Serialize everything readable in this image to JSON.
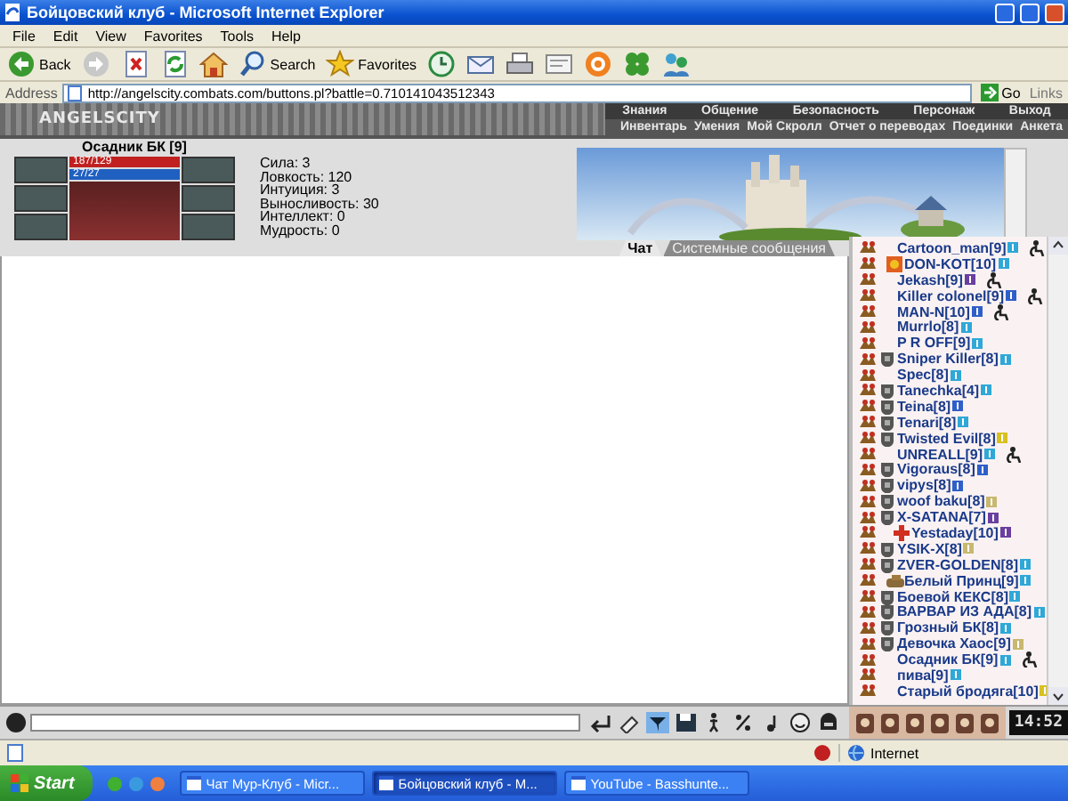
{
  "window": {
    "title": "Бойцовский клуб - Microsoft Internet Explorer"
  },
  "menu": [
    "File",
    "Edit",
    "View",
    "Favorites",
    "Tools",
    "Help"
  ],
  "toolbar": [
    {
      "kind": "back",
      "label": "Back"
    },
    {
      "kind": "forward"
    },
    {
      "kind": "stop"
    },
    {
      "kind": "refresh"
    },
    {
      "kind": "home"
    },
    {
      "kind": "search",
      "label": "Search"
    },
    {
      "kind": "favorites",
      "label": "Favorites"
    },
    {
      "kind": "history"
    },
    {
      "kind": "mail"
    },
    {
      "kind": "print"
    },
    {
      "kind": "edit"
    },
    {
      "kind": "at"
    },
    {
      "kind": "clover"
    },
    {
      "kind": "messenger"
    }
  ],
  "address": {
    "label": "Address",
    "value": "http://angelscity.combats.com/buttons.pl?battle=0.710141043512343",
    "go": "Go",
    "links": "Links"
  },
  "game": {
    "logo": "ANGELSCITY",
    "nav_top": [
      "Знания",
      "Общение",
      "Безопасность",
      "Персонаж",
      "Выход"
    ],
    "nav_bottom": [
      "Инвентарь",
      "Умения",
      "Мой Скролл",
      "Отчет о переводах",
      "Поединки",
      "Анкета"
    ]
  },
  "character": {
    "name": "Осадник БК [9]",
    "hp": {
      "reading": "187/129",
      "level": 1
    },
    "mana": {
      "reading": "27/27",
      "level": 1
    },
    "stats": [
      "Сила: 3",
      "Ловкость: 120",
      "Интуиция: 3",
      "Выносливость: 30",
      "Интеллект: 0",
      "Мудрость: 0"
    ]
  },
  "chat_tabs": [
    {
      "label": "Чат",
      "selected": true
    },
    {
      "label": "Системные сообщения",
      "selected": false
    }
  ],
  "users": [
    {
      "name": "Cartoon_man[9]",
      "kind": "none",
      "color": "#2fa8d8",
      "injured": true
    },
    {
      "name": "DON-KOT[10]",
      "kind": "shield",
      "color": "#2fa8d8",
      "injured": false
    },
    {
      "name": "Jekash[9]",
      "kind": "none",
      "color": "#6a3fa0",
      "injured": true
    },
    {
      "name": "Killer colonel[9]",
      "kind": "none",
      "color": "#2f5fc8",
      "injured": true
    },
    {
      "name": "MAN-N[10]",
      "kind": "none",
      "color": "#2f5fc8",
      "injured": true
    },
    {
      "name": "Murrlo[8]",
      "kind": "none",
      "color": "#2fa8d8",
      "injured": false
    },
    {
      "name": "P R OFF[9]",
      "kind": "none",
      "color": "#2fa8d8",
      "injured": false
    },
    {
      "name": "Sniper Killer[8]",
      "kind": "clan",
      "color": "#2fa8d8",
      "injured": false
    },
    {
      "name": "Spec[8]",
      "kind": "none",
      "color": "#2fa8d8",
      "injured": false
    },
    {
      "name": "Tanechka[4]",
      "kind": "clan",
      "color": "#2fa8d8",
      "injured": false
    },
    {
      "name": "Teina[8]",
      "kind": "clan",
      "color": "#2f5fc8",
      "injured": false
    },
    {
      "name": "Tenari[8]",
      "kind": "clan",
      "color": "#2fa8d8",
      "injured": false
    },
    {
      "name": "Twisted Evil[8]",
      "kind": "clan",
      "color": "#d8c020",
      "injured": false
    },
    {
      "name": "UNREALL[9]",
      "kind": "none",
      "color": "#2fa8d8",
      "injured": true
    },
    {
      "name": "Vigoraus[8]",
      "kind": "clan",
      "color": "#2f5fc8",
      "injured": false
    },
    {
      "name": "vipys[8]",
      "kind": "clan",
      "color": "#2f5fc8",
      "injured": false
    },
    {
      "name": "woof baku[8]",
      "kind": "clan",
      "color": "#c8b870",
      "injured": false
    },
    {
      "name": "X-SATANA[7]",
      "kind": "clan",
      "color": "#6a3fa0",
      "injured": false
    },
    {
      "name": "Yestaday[10]",
      "kind": "cross",
      "color": "#6a3fa0",
      "injured": false
    },
    {
      "name": "YSIK-X[8]",
      "kind": "clan",
      "color": "#c8b870",
      "injured": false
    },
    {
      "name": "ZVER-GOLDEN[8]",
      "kind": "clan",
      "color": "#2fa8d8",
      "injured": false
    },
    {
      "name": "Белый Принц[9]",
      "kind": "tank",
      "color": "#2fa8d8",
      "injured": false
    },
    {
      "name": "Боевой КЕКС[8]",
      "kind": "clan",
      "color": "#2fa8d8",
      "injured": false
    },
    {
      "name": "ВАРВАР ИЗ АДА[8]",
      "kind": "clan",
      "color": "#2fa8d8",
      "injured": false
    },
    {
      "name": "Грозный БК[8]",
      "kind": "clan",
      "color": "#2fa8d8",
      "injured": false
    },
    {
      "name": "Девочка Хаос[9]",
      "kind": "clan",
      "color": "#c8b870",
      "injured": false
    },
    {
      "name": "Осадник БК[9]",
      "kind": "none",
      "color": "#2fa8d8",
      "injured": true
    },
    {
      "name": "пива[9]",
      "kind": "none",
      "color": "#2fa8d8",
      "injured": false
    },
    {
      "name": "Старый бродяга[10]",
      "kind": "none",
      "color": "#d8c020",
      "injured": false
    }
  ],
  "chat_bar": {
    "clock": "14:52"
  },
  "status_bar": {
    "zone": "Internet"
  },
  "taskbar": {
    "start": "Start",
    "tasks": [
      {
        "label": "Чат Мур-Клуб - Micr...",
        "selected": false
      },
      {
        "label": "Бойцовский клуб - M...",
        "selected": true
      },
      {
        "label": "YouTube - Basshunte...",
        "selected": false
      }
    ]
  }
}
